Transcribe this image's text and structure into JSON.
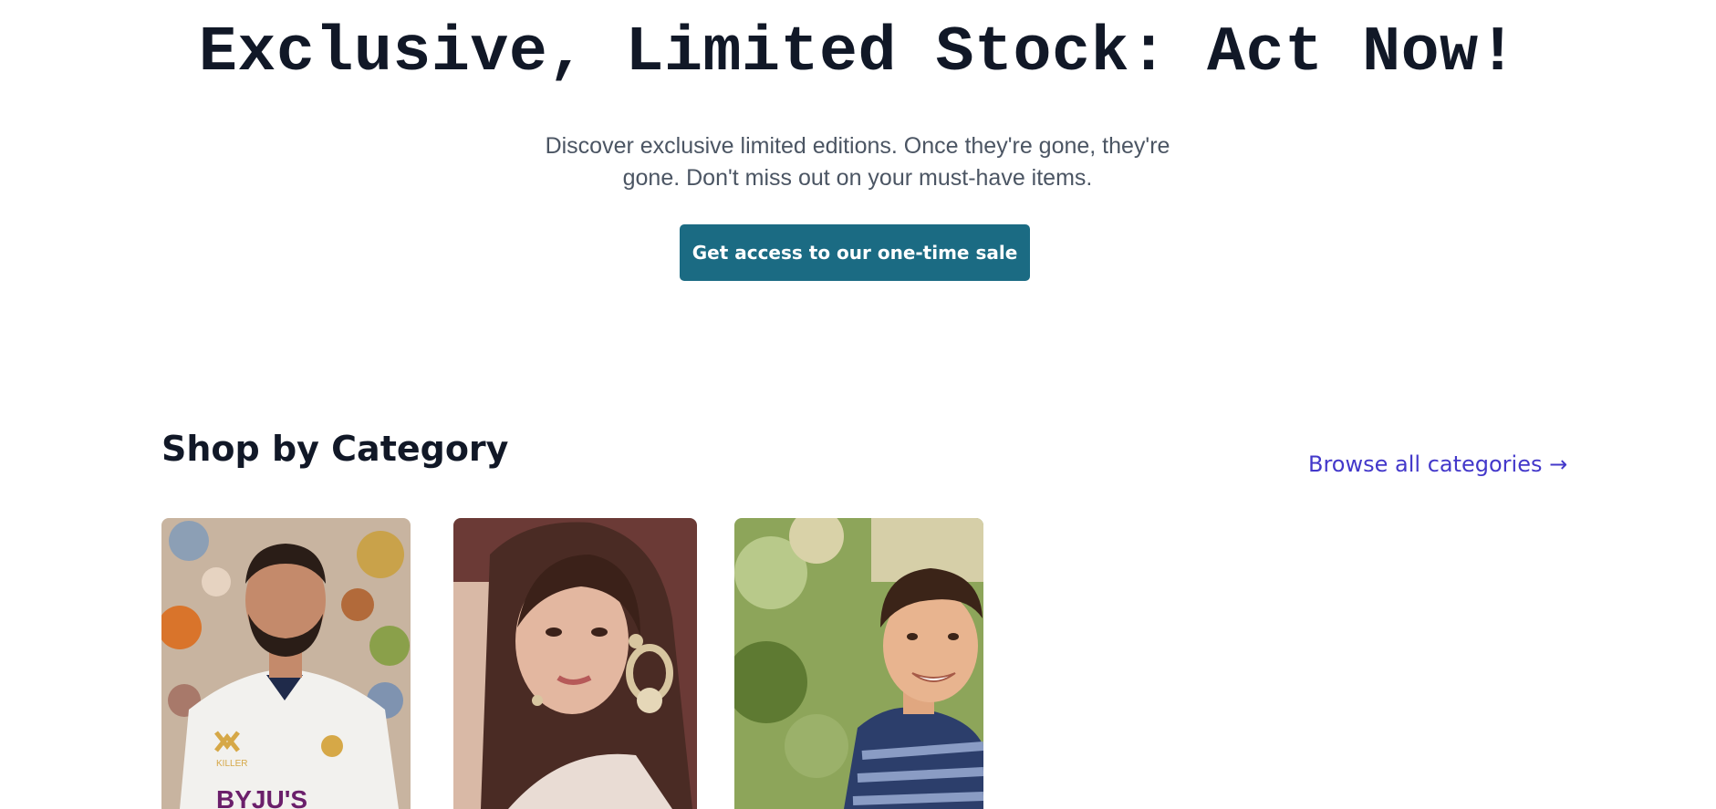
{
  "hero": {
    "title": "Exclusive, Limited Stock: Act Now!",
    "subtitle": "Discover exclusive limited editions. Once they're gone, they're gone. Don't miss out on your must-have items.",
    "cta_label": "Get access to our one-time sale"
  },
  "categories": {
    "heading": "Shop by Category",
    "browse_label": "Browse all categories →",
    "cards": [
      {
        "image": "man-cricket-jersey-photo",
        "jersey_text": "BYJU'S",
        "logo_text": "KILLER"
      },
      {
        "image": "woman-earrings-photo"
      },
      {
        "image": "boy-smiling-photo"
      }
    ]
  },
  "colors": {
    "cta_background": "#1b6b83",
    "link": "#4338ca",
    "heading": "#111827",
    "body_text": "#4b5563"
  }
}
